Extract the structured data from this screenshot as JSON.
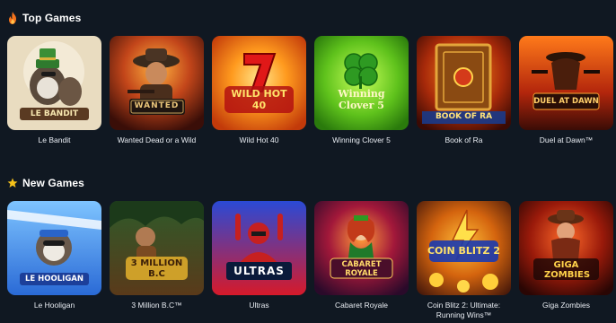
{
  "top_games": {
    "title": "Top Games",
    "icon": "fire-icon",
    "games": [
      {
        "name": "Le Bandit",
        "logo": "LE BANDIT"
      },
      {
        "name": "Wanted Dead or a Wild",
        "logo": "WANTED"
      },
      {
        "name": "Wild Hot 40",
        "logo": "WILD HOT 40"
      },
      {
        "name": "Winning Clover 5",
        "logo": "Winning Clover 5"
      },
      {
        "name": "Book of Ra",
        "logo": "BOOK OF RA"
      },
      {
        "name": "Duel at Dawn™",
        "logo": "DUEL AT DAWN"
      }
    ]
  },
  "new_games": {
    "title": "New Games",
    "icon": "star-icon",
    "games": [
      {
        "name": "Le Hooligan",
        "logo": "LE HOOLIGAN"
      },
      {
        "name": "3 Million B.C™",
        "logo": "3 MILLION B.C"
      },
      {
        "name": "Ultras",
        "logo": "ULTRAS"
      },
      {
        "name": "Cabaret Royale",
        "logo": "CABARET ROYALE"
      },
      {
        "name": "Coin Blitz 2: Ultimate: Running Wins™",
        "logo": "COIN BLITZ 2"
      },
      {
        "name": "Giga Zombies",
        "logo": "GIGA ZOMBIES"
      }
    ]
  },
  "colors": {
    "background": "#101822",
    "fire": "#f5731c",
    "star": "#f6c21a"
  }
}
